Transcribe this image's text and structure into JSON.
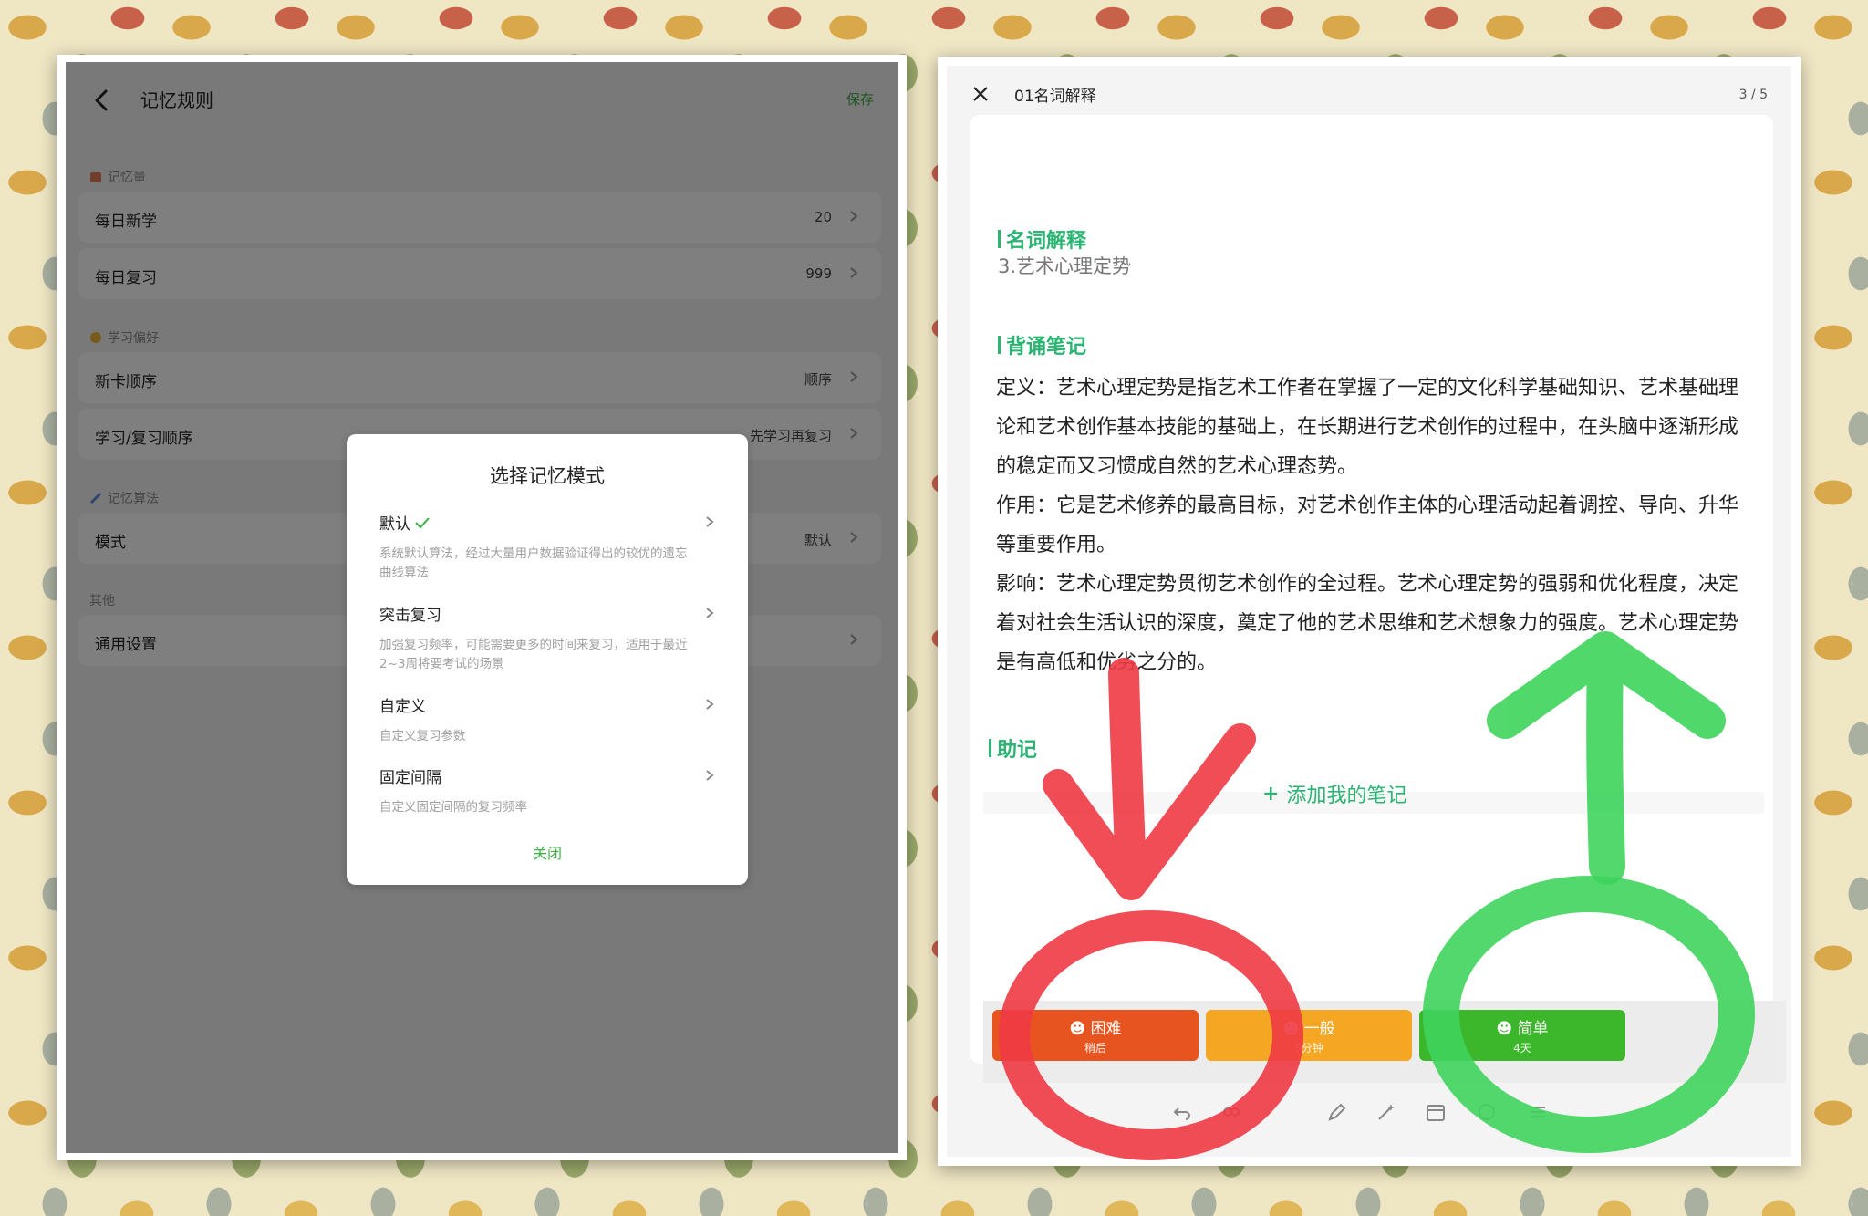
{
  "left": {
    "title": "记忆规则",
    "save_label": "保存",
    "sections": {
      "memory_amount": "记忆量",
      "learning_pref": "学习偏好",
      "algorithm": "记忆算法",
      "other": "其他"
    },
    "rows": {
      "daily_new": {
        "label": "每日新学",
        "value": "20"
      },
      "daily_review": {
        "label": "每日复习",
        "value": "999"
      },
      "card_order": {
        "label": "新卡顺序",
        "value": "顺序"
      },
      "study_order": {
        "label": "学习/复习顺序",
        "value": "先学习再复习"
      },
      "mode": {
        "label": "模式",
        "value": "默认"
      },
      "general": {
        "label": "通用设置",
        "value": ""
      }
    },
    "modal": {
      "title": "选择记忆模式",
      "options": [
        {
          "name": "默认",
          "desc": "系统默认算法，经过大量用户数据验证得出的较优的遗忘曲线算法"
        },
        {
          "name": "突击复习",
          "desc": "加强复习频率，可能需要更多的时间来复习，适用于最近2~3周将要考试的场景"
        },
        {
          "name": "自定义",
          "desc": "自定义复习参数"
        },
        {
          "name": "固定间隔",
          "desc": "自定义固定间隔的复习频率"
        }
      ],
      "close_label": "关闭"
    }
  },
  "right": {
    "title": "01名词解释",
    "page": "3 / 5",
    "heading1": "名词解释",
    "subtitle": "3.艺术心理定势",
    "heading2": "背诵笔记",
    "paragraphs": [
      "定义：艺术心理定势是指艺术工作者在掌握了一定的文化科学基础知识、艺术基础理论和艺术创作基本技能的基础上，在长期进行艺术创作的过程中，在头脑中逐渐形成的稳定而又习惯成自然的艺术心理态势。",
      "作用：它是艺术修养的最高目标，对艺术创作主体的心理活动起着调控、导向、升华等重要作用。",
      "影响：艺术心理定势贯彻艺术创作的全过程。艺术心理定势的强弱和优化程度，决定着对社会生活认识的深度，奠定了他的艺术思维和艺术想象力的强度。艺术心理定势是有高低和优劣之分的。"
    ],
    "heading3": "助记",
    "add_note_label": "添加我的笔记",
    "grades": [
      {
        "label": "困难",
        "sub": "稍后",
        "color": "#e8541f"
      },
      {
        "label": "一般",
        "sub": "5分钟",
        "color": "#f5a623"
      },
      {
        "label": "简单",
        "sub": "4天",
        "color": "#3cb62a"
      }
    ]
  },
  "colors": {
    "accent_green": "#2bb573",
    "save_green": "#3cb043",
    "arrow_red": "#f03a45",
    "arrow_green": "#3fd45c"
  }
}
